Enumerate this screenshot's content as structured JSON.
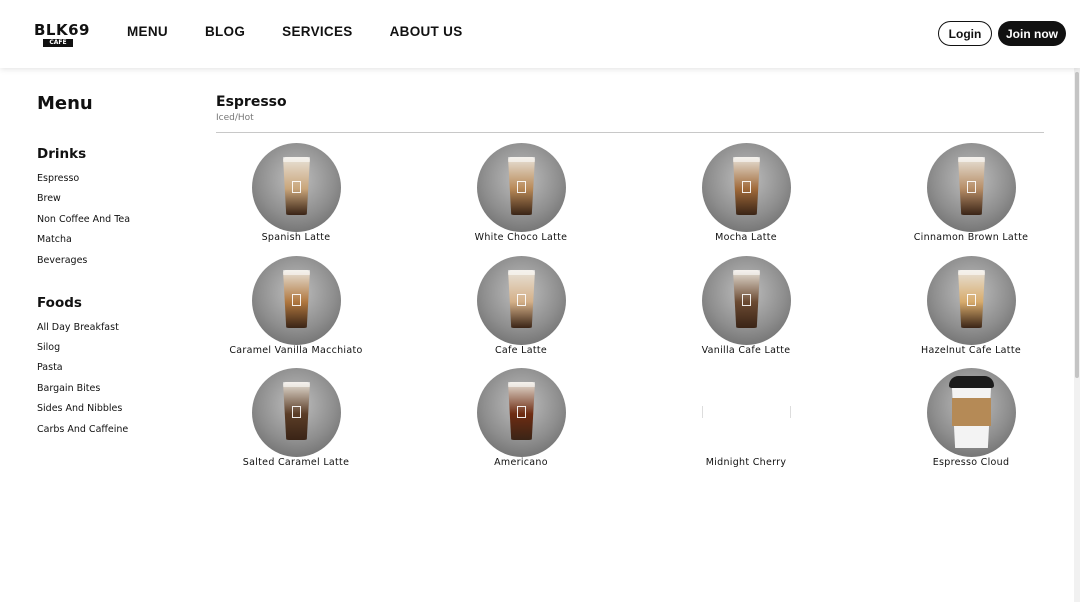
{
  "brand": {
    "logo_text": "BLK69",
    "logo_sub": "CAFE"
  },
  "nav": {
    "items": [
      "MENU",
      "BLOG",
      "SERVICES",
      "ABOUT US"
    ]
  },
  "auth": {
    "login": "Login",
    "join": "Join now"
  },
  "sidebar": {
    "title": "Menu",
    "sections": [
      {
        "title": "Drinks",
        "items": [
          "Espresso",
          "Brew",
          "Non Coffee And Tea",
          "Matcha",
          "Beverages"
        ]
      },
      {
        "title": "Foods",
        "items": [
          "All Day Breakfast",
          "Silog",
          "Pasta",
          "Bargain Bites",
          "Sides And Nibbles",
          "Carbs And Caffeine"
        ]
      }
    ]
  },
  "category": {
    "title": "Espresso",
    "subtitle": "Iced/Hot",
    "products": [
      {
        "name": "Spanish Latte",
        "image": "photo",
        "color": "#c9a57a"
      },
      {
        "name": "White Choco Latte",
        "image": "photo",
        "color": "#b88957"
      },
      {
        "name": "Mocha Latte",
        "image": "photo",
        "color": "#a06a3a"
      },
      {
        "name": "Cinnamon Brown Latte",
        "image": "photo",
        "color": "#b68d66"
      },
      {
        "name": "Caramel Vanilla Macchiato",
        "image": "photo",
        "color": "#b0773f"
      },
      {
        "name": "Cafe Latte",
        "image": "photo",
        "color": "#d4b088"
      },
      {
        "name": "Vanilla Cafe Latte",
        "image": "photo",
        "color": "#6b4a32"
      },
      {
        "name": "Hazelnut Cafe Latte",
        "image": "photo",
        "color": "#d7ab6c"
      },
      {
        "name": "Salted Caramel Latte",
        "image": "photo",
        "color": "#5b3d27"
      },
      {
        "name": "Americano",
        "image": "photo",
        "color": "#6e2c12"
      },
      {
        "name": "Midnight Cherry",
        "image": "none",
        "color": "#ffffff"
      },
      {
        "name": "Espresso Cloud",
        "image": "sleeve",
        "color": "#b58a56"
      }
    ]
  }
}
